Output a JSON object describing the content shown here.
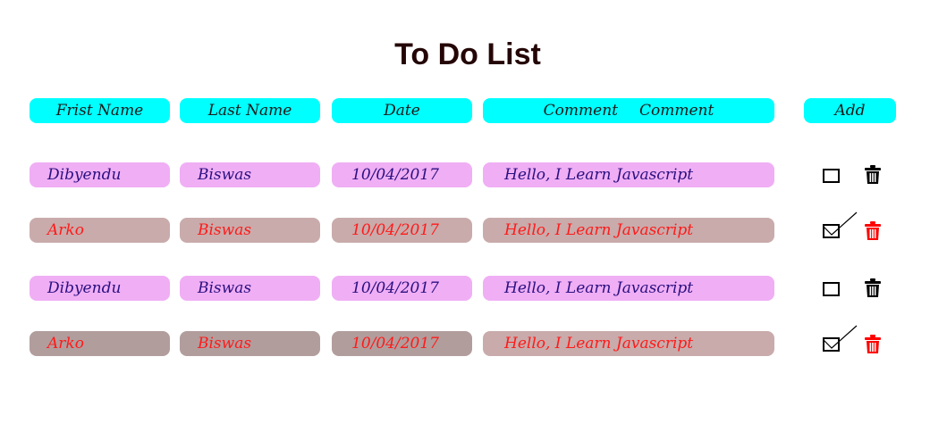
{
  "title": "To Do List",
  "headers": {
    "first_name": "Frist Name",
    "last_name": "Last Name",
    "date": "Date",
    "comment_a": "Comment",
    "comment_b": "Comment",
    "add": "Add"
  },
  "rows": [
    {
      "first": "Dibyendu",
      "last": "Biswas",
      "date": "10/04/2017",
      "comment": "Hello, I Learn Javascript",
      "checked": false
    },
    {
      "first": "Arko",
      "last": "Biswas",
      "date": "10/04/2017",
      "comment": "Hello, I Learn Javascript",
      "checked": true
    },
    {
      "first": "Dibyendu",
      "last": "Biswas",
      "date": "10/04/2017",
      "comment": "Hello, I Learn Javascript",
      "checked": false
    },
    {
      "first": "Arko",
      "last": "Biswas",
      "date": "10/04/2017",
      "comment": "Hello, I Learn Javascript",
      "checked": true
    }
  ],
  "colors": {
    "header_bg": "#00ffff",
    "pending_bg": "#f0aef5",
    "pending_text": "#2a1080",
    "done_bg": "#c9abab",
    "done_text": "#ff1a1a"
  },
  "icons": {
    "checkbox": "checkbox-icon",
    "delete": "trash-icon"
  }
}
